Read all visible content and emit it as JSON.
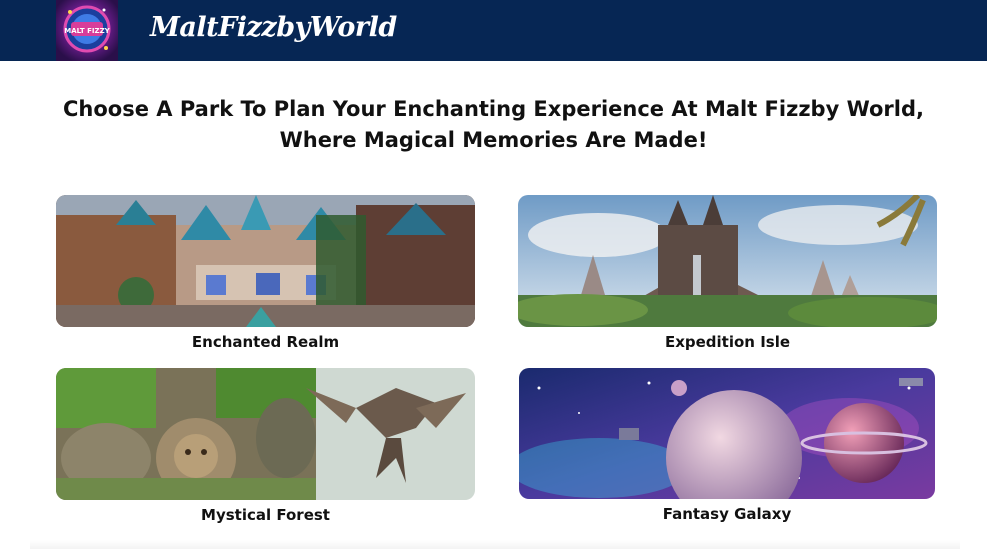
{
  "header": {
    "logo_text": "MALT FIZZY",
    "brand_name": "MaltFizzbyWorld"
  },
  "headline": {
    "line1": "Choose A Park To Plan Your Enchanting Experience At Malt Fizzby World,",
    "line2": "Where Magical Memories Are Made!"
  },
  "parks": [
    {
      "name": "Enchanted Realm"
    },
    {
      "name": "Expedition Isle"
    },
    {
      "name": "Mystical Forest"
    },
    {
      "name": "Fantasy Galaxy"
    }
  ],
  "colors": {
    "header_bg": "#062654",
    "text": "#111111"
  }
}
